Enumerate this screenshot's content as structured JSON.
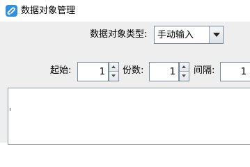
{
  "window": {
    "title": "数据对象管理",
    "icon": "app-logo-icon"
  },
  "data_object": {
    "type_label": "数据对象类型:",
    "type_value": "手动输入"
  },
  "fields": {
    "start": {
      "label": "起始:",
      "value": "1"
    },
    "copies": {
      "label": "份数:",
      "value": "1"
    },
    "interval": {
      "label": "间隔:",
      "value": "1"
    }
  },
  "text_area": {
    "value": ""
  },
  "colors": {
    "background": "#eeeeee",
    "title_bar": "#ffffff",
    "icon_blue": "#2f8fe0",
    "border": "#7a8a9a"
  }
}
